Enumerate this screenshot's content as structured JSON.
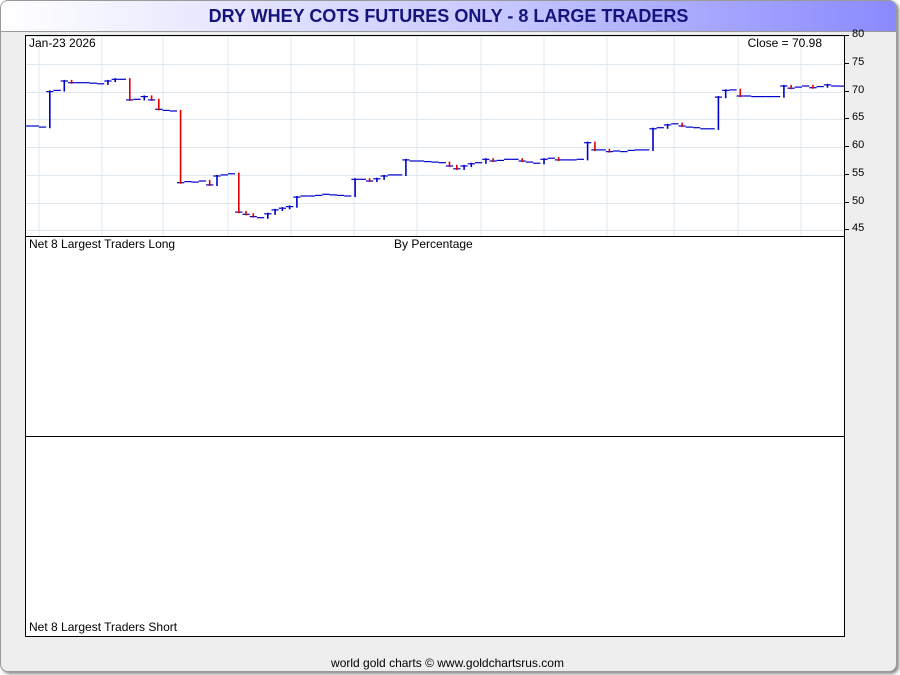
{
  "title": "DRY WHEY COTS FUTURES ONLY - 8 LARGE TRADERS",
  "footer": "world gold charts © www.goldchartsrus.com",
  "price_panel": {
    "date_label": "Jan-23  2026",
    "close_label": "Close = 70.98"
  },
  "long_panel": {
    "label": "Net 8 Largest Traders Long",
    "sublabel": "By Percentage"
  },
  "short_panel": {
    "label": "Net 8 Largest Traders Short"
  },
  "colors": {
    "up": "#0000cc",
    "down": "#dd0000",
    "grid": "#dfe8ee",
    "title_text": "#14147a"
  },
  "chart_data": {
    "type": "line",
    "title": "DRY WHEY COTS FUTURES ONLY - 8 LARGE TRADERS",
    "ylim": [
      44,
      80
    ],
    "yticks": [
      80,
      75,
      70,
      65,
      60,
      55,
      50,
      45
    ],
    "grid": true,
    "series": [
      {
        "values": [
          63.8,
          63.8,
          63.6,
          70,
          70.2,
          71.9,
          71.6,
          71.6,
          71.6,
          71.5,
          71.4,
          71.9,
          72.2,
          72.2,
          68.5,
          68.6,
          69.1,
          68.5,
          66.8,
          66.6,
          66.5,
          53.6,
          53.8,
          53.7,
          53.9,
          53.2,
          54.8,
          55,
          55.2,
          48.3,
          47.9,
          47.5,
          47.3,
          48,
          48.7,
          49,
          49.3,
          51,
          51.2,
          51.2,
          51.3,
          51.5,
          51.4,
          51.3,
          51.2,
          54.2,
          54.2,
          53.9,
          54.3,
          54.8,
          55,
          55,
          57.7,
          57.5,
          57.5,
          57.4,
          57.3,
          57.2,
          56.6,
          56.1,
          56.6,
          57,
          57.2,
          57.8,
          57.5,
          57.6,
          57.8,
          57.8,
          57.5,
          57.3,
          57.1,
          57.8,
          58,
          57.7,
          57.7,
          57.7,
          57.8,
          60.8,
          59.5,
          59.5,
          59.2,
          59.3,
          59.2,
          59.4,
          59.5,
          59.5,
          63.3,
          63.5,
          64,
          64.2,
          63.8,
          63.6,
          63.5,
          63.3,
          63.3,
          69,
          70.2,
          70.3,
          69.2,
          69.2,
          69.1,
          69.1,
          69.1,
          69.1,
          71,
          70.6,
          70.8,
          71,
          70.7,
          70.9,
          71.2,
          71,
          70.98
        ]
      }
    ]
  }
}
